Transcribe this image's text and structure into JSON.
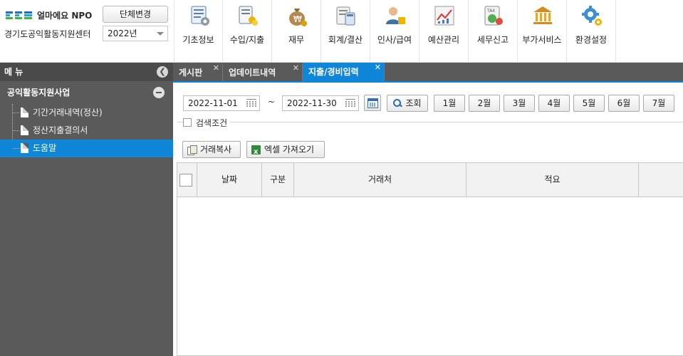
{
  "header": {
    "brand_name": "얼마에요 NPO",
    "brand_colors": [
      "#1d6fc4",
      "#2aa0d8",
      "#3bb54a"
    ],
    "group_change_label": "단체변경",
    "org_name": "경기도공익활동지원센터",
    "year_value": "2022년",
    "nav": [
      {
        "label": "기초정보",
        "icon": "basic-info-icon"
      },
      {
        "label": "수입/지출",
        "icon": "income-expense-icon"
      },
      {
        "label": "재무",
        "icon": "finance-money-bag-icon"
      },
      {
        "label": "회계/결산",
        "icon": "accounting-calculator-icon"
      },
      {
        "label": "인사/급여",
        "icon": "personnel-payroll-icon"
      },
      {
        "label": "예산관리",
        "icon": "budget-chart-icon"
      },
      {
        "label": "세무신고",
        "icon": "tax-report-icon"
      },
      {
        "label": "부가서비스",
        "icon": "bank-service-icon"
      },
      {
        "label": "환경설정",
        "icon": "settings-gear-icon"
      }
    ]
  },
  "sidebar": {
    "title": "메 뉴",
    "section": "공익활동지원사업",
    "items": [
      {
        "label": "기간거래내역(정산)"
      },
      {
        "label": "정산지출결의서"
      },
      {
        "label": "도움말"
      }
    ]
  },
  "tabs": [
    {
      "label": "게시판"
    },
    {
      "label": "업데이트내역"
    },
    {
      "label": "지출/경비입력"
    }
  ],
  "filters": {
    "start_date": "2022-11-01",
    "end_date": "2022-11-30",
    "tilde": "~",
    "search_label": "조회",
    "months": [
      "1월",
      "2월",
      "3월",
      "4월",
      "5월",
      "6월",
      "7월"
    ],
    "condition_label": "검색조건"
  },
  "actions": {
    "copy_label": "거래복사",
    "excel_label": "엑셀 가져오기"
  },
  "table": {
    "columns": [
      "날짜",
      "구분",
      "거래처",
      "적요"
    ]
  },
  "colors": {
    "accent": "#0f86d8",
    "sidebar_bg": "#5a5a5a"
  }
}
